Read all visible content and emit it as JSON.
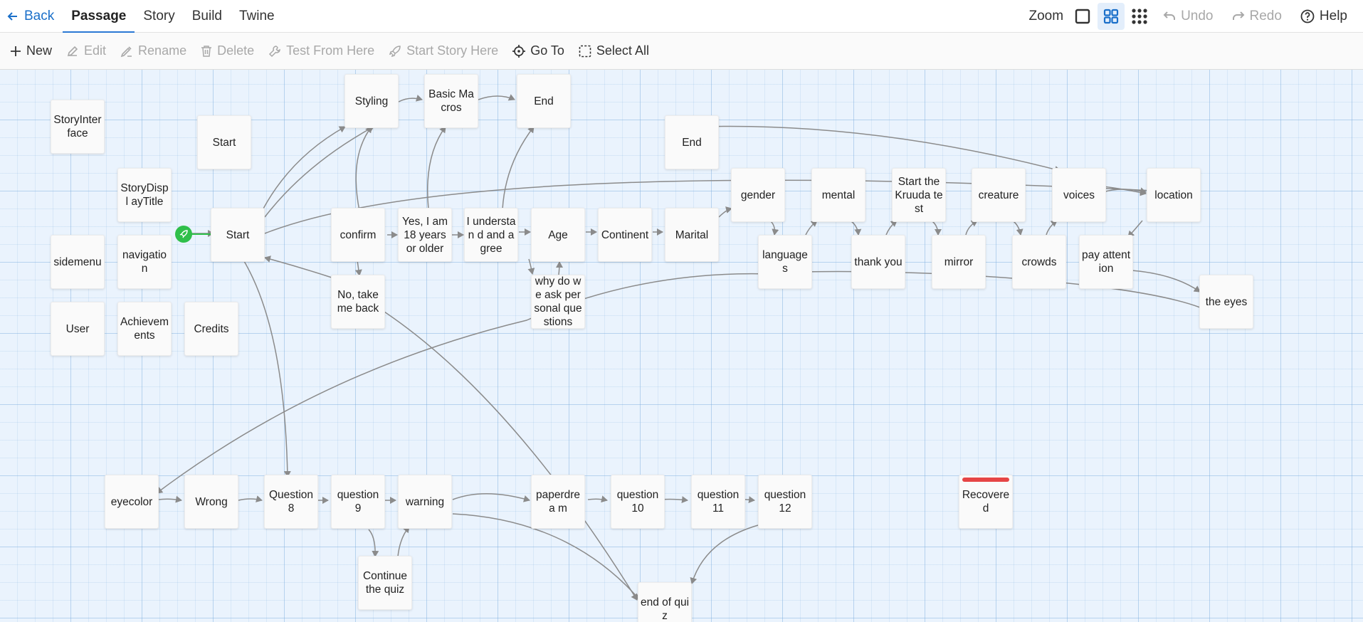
{
  "nav": {
    "back": "Back",
    "tabs": [
      "Passage",
      "Story",
      "Build",
      "Twine"
    ],
    "zoom": "Zoom",
    "undo": "Undo",
    "redo": "Redo",
    "help": "Help"
  },
  "toolbar": {
    "new": "New",
    "edit": "Edit",
    "rename": "Rename",
    "delete": "Delete",
    "test": "Test From Here",
    "start": "Start Story Here",
    "goto": "Go To",
    "select_all": "Select All"
  },
  "colors": {
    "accent": "#2b78d4",
    "start": "#2fbf4a",
    "tag": "#e64545"
  },
  "passages": [
    {
      "id": "storyinterface",
      "name": "StoryInter face"
    },
    {
      "id": "start-top",
      "name": "Start"
    },
    {
      "id": "styling",
      "name": "Styling"
    },
    {
      "id": "basic-macros",
      "name": "Basic Macros"
    },
    {
      "id": "end-top",
      "name": "End"
    },
    {
      "id": "end-2",
      "name": "End"
    },
    {
      "id": "storydisplaytitle",
      "name": "StoryDispl ayTitle"
    },
    {
      "id": "start-main",
      "name": "Start"
    },
    {
      "id": "confirm",
      "name": "confirm"
    },
    {
      "id": "yes18",
      "name": "Yes, I am 18 years or older"
    },
    {
      "id": "understand",
      "name": "I understan d and agree"
    },
    {
      "id": "age",
      "name": "Age"
    },
    {
      "id": "continent",
      "name": "Continent"
    },
    {
      "id": "marital",
      "name": "Marital"
    },
    {
      "id": "gender",
      "name": "gender"
    },
    {
      "id": "mental",
      "name": "mental"
    },
    {
      "id": "kruuda",
      "name": "Start the Kruuda test"
    },
    {
      "id": "creature",
      "name": "creature"
    },
    {
      "id": "voices",
      "name": "voices"
    },
    {
      "id": "location",
      "name": "location"
    },
    {
      "id": "sidemenu",
      "name": "sidemenu"
    },
    {
      "id": "navigation",
      "name": "navigatio n"
    },
    {
      "id": "languages",
      "name": "languages"
    },
    {
      "id": "thankyou",
      "name": "thank you"
    },
    {
      "id": "mirror",
      "name": "mirror"
    },
    {
      "id": "crowds",
      "name": "crowds"
    },
    {
      "id": "payattention",
      "name": "pay attention"
    },
    {
      "id": "theeyes",
      "name": "the eyes"
    },
    {
      "id": "notakemeback",
      "name": "No, take me back"
    },
    {
      "id": "whydoweask",
      "name": "why do we ask personal questions"
    },
    {
      "id": "user",
      "name": "User"
    },
    {
      "id": "achievements",
      "name": "Achievem ents"
    },
    {
      "id": "credits",
      "name": "Credits"
    },
    {
      "id": "eyecolor",
      "name": "eyecolor"
    },
    {
      "id": "wrong",
      "name": "Wrong"
    },
    {
      "id": "question8",
      "name": "Question 8"
    },
    {
      "id": "question9",
      "name": "question 9"
    },
    {
      "id": "warning",
      "name": "warning"
    },
    {
      "id": "paperdream",
      "name": "paperdrea m"
    },
    {
      "id": "question10",
      "name": "question 10"
    },
    {
      "id": "question11",
      "name": "question 11"
    },
    {
      "id": "question12",
      "name": "question 12"
    },
    {
      "id": "recovered",
      "name": "Recovere d"
    },
    {
      "id": "continuequiz",
      "name": "Continue the quiz"
    },
    {
      "id": "endofquiz",
      "name": "end of quiz"
    }
  ]
}
